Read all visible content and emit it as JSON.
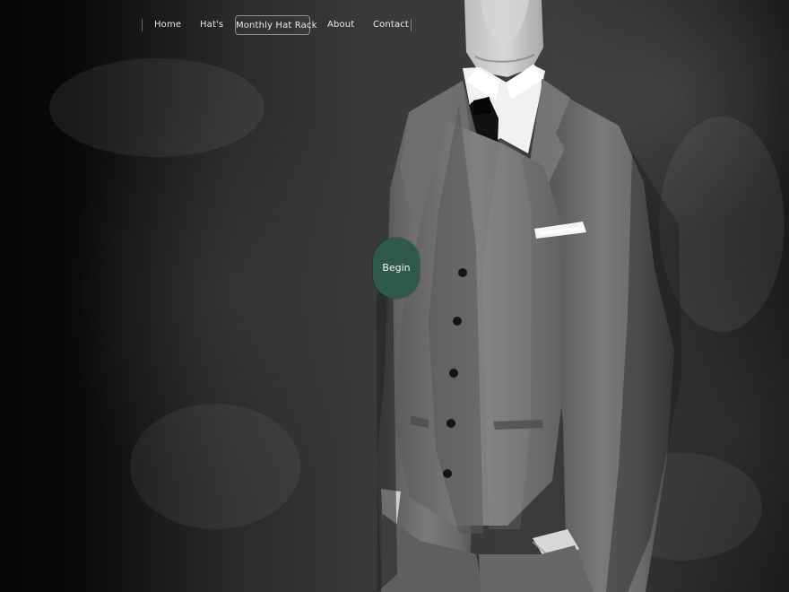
{
  "navigation": {
    "items": [
      {
        "label": "Home"
      },
      {
        "label": "Hat's"
      },
      {
        "label": "Monthly Hat Rack"
      },
      {
        "label": "About"
      },
      {
        "label": "Contact"
      }
    ],
    "active_label": "Monthly Hat Rack"
  },
  "hero": {
    "button_label": "Begin",
    "button_color": "#2f5a4a",
    "image_name": "man-in-suit-photo"
  },
  "colors": {
    "background": "#000000",
    "text": "#e9e9e9",
    "accent": "#2f5a4a"
  }
}
